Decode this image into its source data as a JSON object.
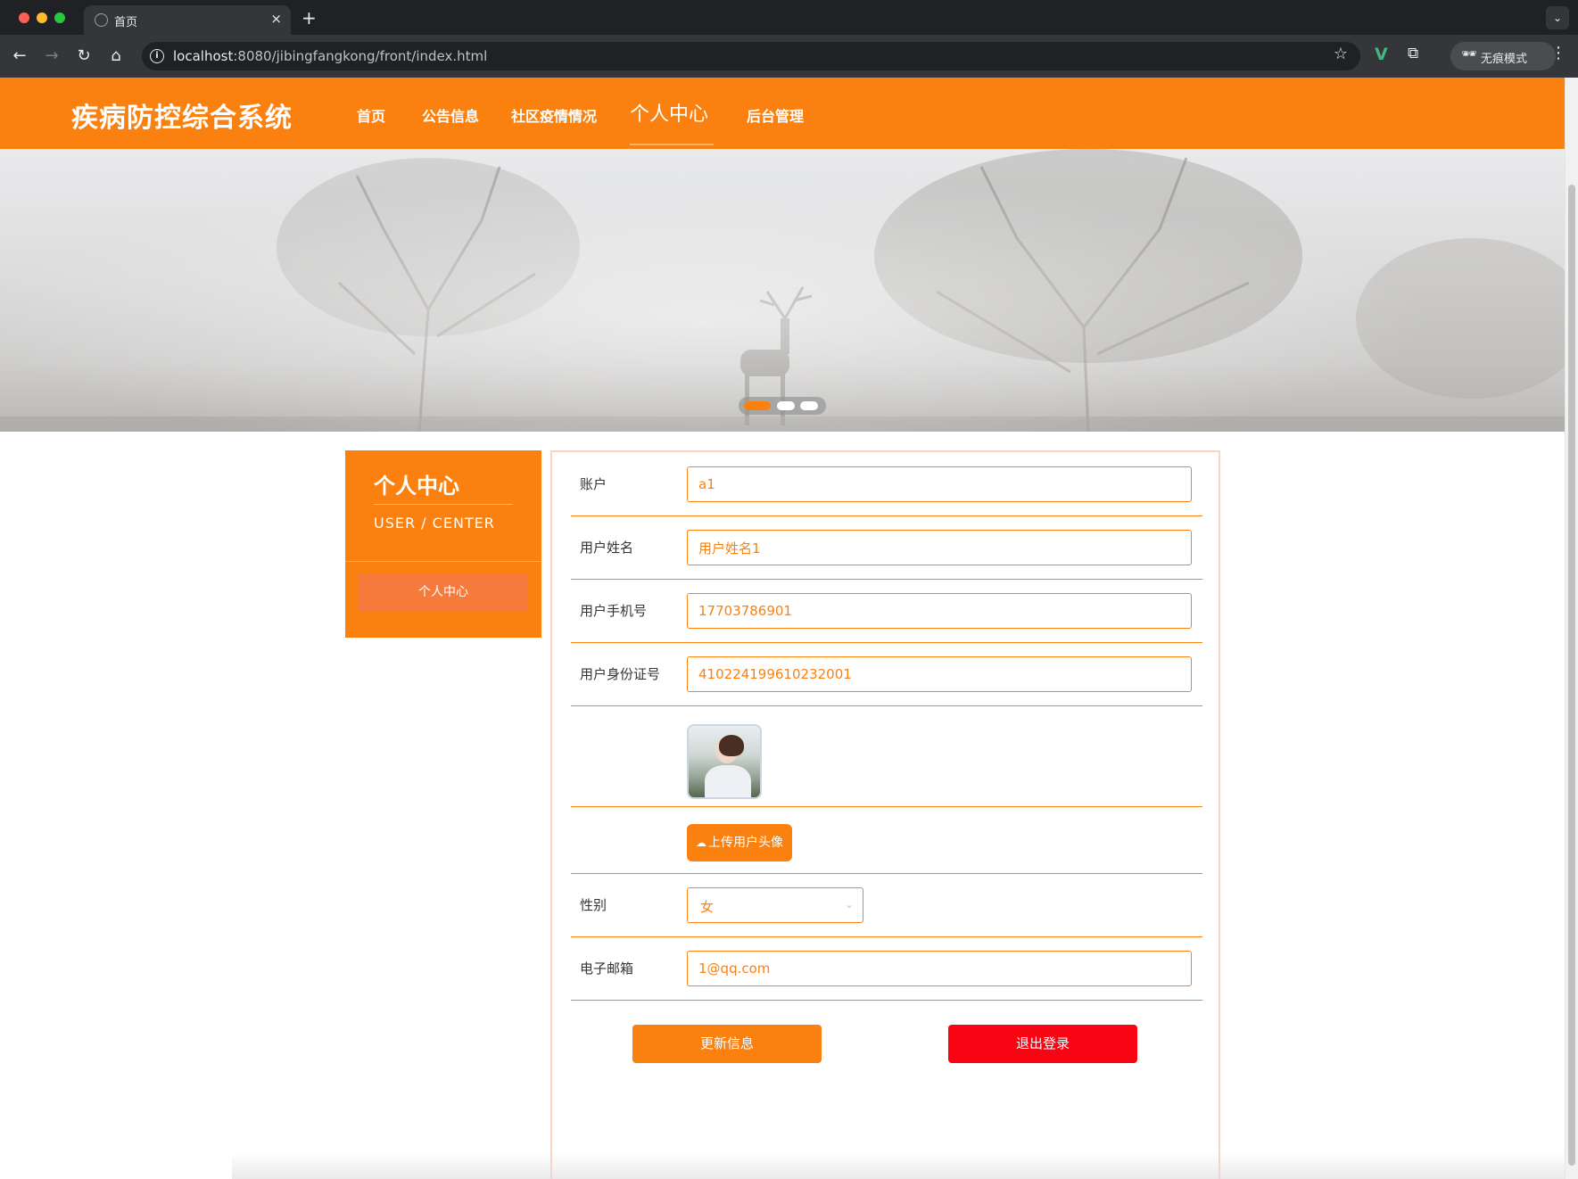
{
  "browser": {
    "tab_title": "首页",
    "tab_close": "×",
    "new_tab": "+",
    "tab_menu": "⌄",
    "url_host": "localhost",
    "url_path": ":8080/jibingfangkong/front/index.html",
    "incognito_label": "无痕模式",
    "icons": {
      "back": "←",
      "forward": "→",
      "reload": "↻",
      "home": "⌂",
      "info": "i",
      "star": "☆",
      "vue": "V",
      "extensions": "⧉",
      "incognito": "🕶",
      "menu": "⋮"
    }
  },
  "site": {
    "title": "疾病防控综合系统",
    "nav": [
      {
        "label": "首页",
        "active": false
      },
      {
        "label": "公告信息",
        "active": false
      },
      {
        "label": "社区疫情情况",
        "active": false
      },
      {
        "label": "个人中心",
        "active": true
      },
      {
        "label": "后台管理",
        "active": false
      }
    ],
    "accent_color": "#fa8010",
    "danger_color": "#f90412"
  },
  "banner": {
    "slides": 3,
    "active_slide": 1
  },
  "side_panel": {
    "title": "个人中心",
    "subtitle": "USER / CENTER",
    "button": "个人中心"
  },
  "form": {
    "fields": [
      {
        "label": "账户",
        "value": "a1"
      },
      {
        "label": "用户姓名",
        "value": "用户姓名1"
      },
      {
        "label": "用户手机号",
        "value": "17703786901"
      },
      {
        "label": "用户身份证号",
        "value": "410224199610232001"
      }
    ],
    "upload_icon": "☁",
    "upload_label": "上传用户头像",
    "gender": {
      "label": "性别",
      "value": "女",
      "chevron": "⌄"
    },
    "email": {
      "label": "电子邮箱",
      "value": "1@qq.com"
    },
    "update_label": "更新信息",
    "logout_label": "退出登录"
  }
}
